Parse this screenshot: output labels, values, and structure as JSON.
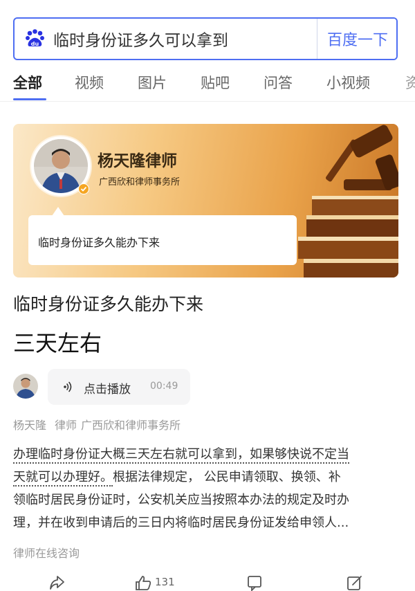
{
  "search": {
    "query": "临时身份证多久可以拿到",
    "button_label": "百度一下"
  },
  "tabs": [
    {
      "label": "全部",
      "active": true
    },
    {
      "label": "视频",
      "active": false
    },
    {
      "label": "图片",
      "active": false
    },
    {
      "label": "贴吧",
      "active": false
    },
    {
      "label": "问答",
      "active": false
    },
    {
      "label": "小视频",
      "active": false
    },
    {
      "label": "资",
      "active": false
    }
  ],
  "banner": {
    "lawyer_name": "杨天隆律师",
    "firm": "广西欣和律师事务所",
    "bubble_text": "临时身份证多久能办下来"
  },
  "answer": {
    "question": "临时身份证多久能办下来",
    "headline": "三天左右"
  },
  "audio": {
    "label": "点击播放",
    "duration": "00:49"
  },
  "meta": {
    "name": "杨天隆",
    "role": "律师",
    "firm": "广西欣和律师事务所"
  },
  "body": {
    "line1_dotted": "办理临时身份证大概三天左右就可以拿到，如果够快说不定当",
    "line2_dotted": "天就可以办理好。",
    "line2_rest": "根据法律规定， 公民申请领取、换领、补",
    "line3": "领临时居民身份证时，公安机关应当按照本办法的规定及时办",
    "line4": "理，并在收到申请后的三日内将临时居民身份证发给申领人..."
  },
  "consult_label": "律师在线咨询",
  "actions": {
    "like_count": "131"
  },
  "colors": {
    "brand_blue": "#4e6ef2",
    "banner_orange": "#e9a24a",
    "text_gray": "#9a9a9a"
  }
}
